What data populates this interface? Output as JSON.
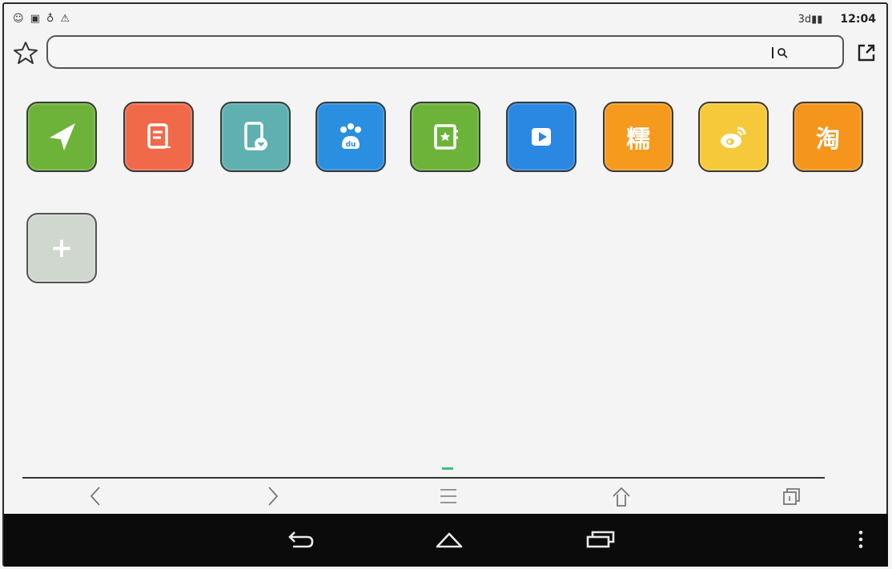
{
  "status_bar": {
    "left_icons": [
      "☺",
      "▣",
      "♁",
      "⚠"
    ],
    "signal_text": "3d▮▮",
    "time": "12:04"
  },
  "address_bar": {
    "url_value": "",
    "url_placeholder": ""
  },
  "tiles": [
    {
      "name": "navigation-tile",
      "color": "#6db33a",
      "icon": "navigation-arrow-icon"
    },
    {
      "name": "notes-tile",
      "color": "#f06a4a",
      "icon": "document-icon"
    },
    {
      "name": "phone-favorites-tile",
      "color": "#5fb0b0",
      "icon": "phone-heart-icon"
    },
    {
      "name": "baidu-tile",
      "color": "#2a8fe0",
      "icon": "paw-icon"
    },
    {
      "name": "bookmarks-tile",
      "color": "#6db33a",
      "icon": "book-star-icon"
    },
    {
      "name": "video-tile",
      "color": "#2a87e2",
      "icon": "play-icon"
    },
    {
      "name": "nuomi-tile",
      "color": "#f59a1c",
      "icon": "nuo-glyph-icon",
      "glyph": "糯"
    },
    {
      "name": "weibo-tile",
      "color": "#f6c93a",
      "icon": "weibo-icon"
    },
    {
      "name": "taobao-tile",
      "color": "#f5951c",
      "icon": "tao-glyph-icon",
      "glyph": "淘"
    },
    {
      "name": "add-tile",
      "color": "#cfd7ce",
      "icon": "plus-icon",
      "glyph": "+"
    }
  ],
  "toolbar": {
    "back_icon": "chevron-left-icon",
    "forward_icon": "chevron-right-icon",
    "menu_icon": "menu-icon",
    "home_icon": "home-icon",
    "tabs_icon": "tabs-icon",
    "indicator_color": "#3cc07a"
  },
  "navbar": {
    "back_icon": "back-icon",
    "home_icon": "home-icon",
    "recents_icon": "recents-icon",
    "overflow_icon": "overflow-icon"
  }
}
